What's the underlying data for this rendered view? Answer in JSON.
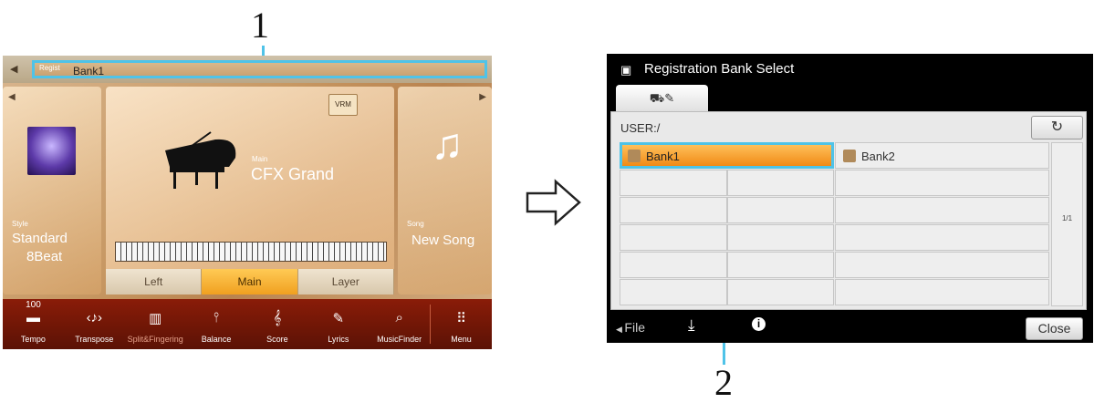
{
  "callouts": {
    "one": "1",
    "two": "2"
  },
  "home": {
    "regist": {
      "label": "Regist",
      "value": "Bank1"
    },
    "style": {
      "label": "Style",
      "name_line1": "Standard",
      "name_line2": "8Beat"
    },
    "main": {
      "label": "Main",
      "name": "CFX Grand",
      "vrm": "VRM"
    },
    "song": {
      "label": "Song",
      "name": "New Song"
    },
    "parts": [
      "Left",
      "Main",
      "Layer"
    ],
    "bottom": {
      "tempo_value": "100",
      "buttons": [
        "Tempo",
        "Transpose",
        "Split&Fingering",
        "Balance",
        "Score",
        "Lyrics",
        "MusicFinder",
        "Menu"
      ]
    }
  },
  "bank": {
    "title": "Registration Bank Select",
    "path": "USER:/",
    "up_icon": "refresh-icon",
    "items": [
      "Bank1",
      "Bank2"
    ],
    "page": "1/1",
    "file": "File",
    "close": "Close"
  },
  "colors": {
    "highlight": "#4fc3e8",
    "accent": "#f0a020"
  }
}
